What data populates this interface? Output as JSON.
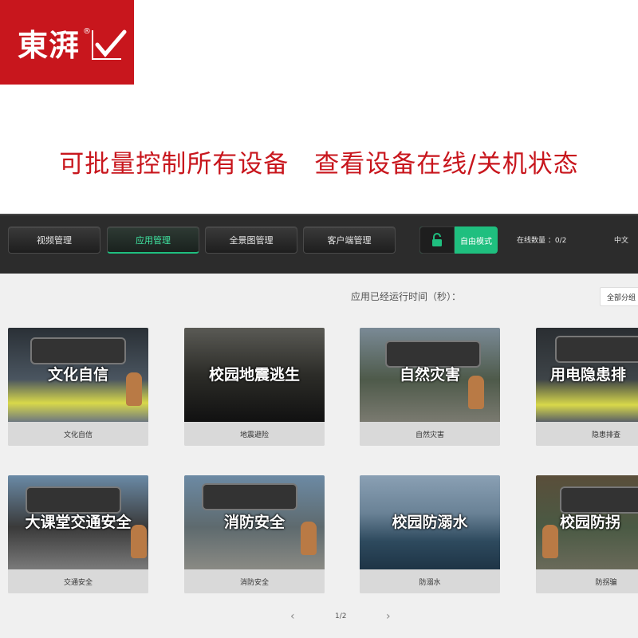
{
  "brand": {
    "name": "東湃",
    "reg": "®"
  },
  "headline": "可批量控制所有设备　查看设备在线/关机状态",
  "nav": {
    "items": [
      {
        "label": "视频管理",
        "active": false
      },
      {
        "label": "应用管理",
        "active": true
      },
      {
        "label": "全景图管理",
        "active": false
      },
      {
        "label": "客户端管理",
        "active": false
      }
    ]
  },
  "mode": {
    "label": "自由模式",
    "icon": "unlock-icon"
  },
  "status": {
    "online": "在线数量 ：0/2",
    "language": "中文"
  },
  "runtime_label": "应用已经运行时间（秒）：",
  "group_select": "全部分组",
  "apps": [
    {
      "title": "文化自信",
      "caption": "文化自信"
    },
    {
      "title": "校园地震逃生",
      "caption": "地震避险"
    },
    {
      "title": "自然灾害",
      "caption": "自然灾害"
    },
    {
      "title": "用电隐患排",
      "caption": "隐患排查"
    },
    {
      "title": "大课堂交通安全",
      "caption": "交通安全"
    },
    {
      "title": "消防安全",
      "caption": "消防安全"
    },
    {
      "title": "校园防溺水",
      "caption": "防溺水"
    },
    {
      "title": "校园防拐",
      "caption": "防拐骗"
    }
  ],
  "pagination": {
    "prev": "‹",
    "next": "›",
    "page": "1/2"
  },
  "colors": {
    "brand_red": "#c8161d",
    "accent_green": "#1fbf7f",
    "topbar": "#2c2c2c"
  }
}
